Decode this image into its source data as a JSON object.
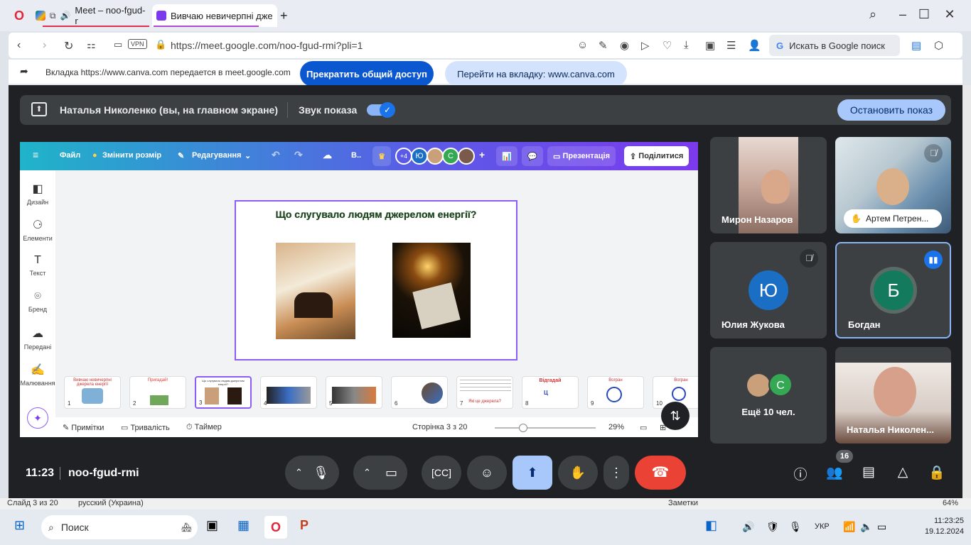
{
  "browser": {
    "tabs": [
      {
        "label": "Meet – noo-fgud-r"
      },
      {
        "label": "Вивчаю невичерпні дже"
      }
    ],
    "url": "https://meet.google.com/noo-fgud-rmi?pli=1",
    "vpn_label": "VPN",
    "google_search": "Искать в Google поиск"
  },
  "share_bar": {
    "text": "Вкладка https://www.canva.com передается в meet.google.com",
    "stop_label": "Прекратить общий доступ",
    "goto_label": "Перейти на вкладку: www.canva.com"
  },
  "presenter_bar": {
    "name": "Наталья Николенко (вы, на главном экране)",
    "sound_label": "Звук показа",
    "stop_label": "Остановить показ"
  },
  "canva": {
    "menu_file": "Файл",
    "resize": "Змінити розмір",
    "editing": "Редагування",
    "extra_label": "В..",
    "plus_count": "+4",
    "avatar_yu": "Ю",
    "avatar_s": "С",
    "present": "Презентація",
    "share": "Поділитися",
    "side": [
      "Дизайн",
      "Елементи",
      "Текст",
      "Бренд",
      "Передані",
      "Малювання"
    ],
    "slide_title": "Що слугувало людям джерелом енергії?",
    "thumbs": [
      {
        "num": "1",
        "title": "Вивчаю невичерпні джерела енергії"
      },
      {
        "num": "2",
        "title": "Пригадай!"
      },
      {
        "num": "3",
        "title": "Що слугувало людям джерелом енергії?"
      },
      {
        "num": "4",
        "title": ""
      },
      {
        "num": "5",
        "title": ""
      },
      {
        "num": "6",
        "title": ""
      },
      {
        "num": "7",
        "title": "Які це джерела?"
      },
      {
        "num": "8",
        "title": "Відгадай"
      },
      {
        "num": "9",
        "title": "Вогран"
      },
      {
        "num": "10",
        "title": "Вогран"
      }
    ],
    "notes": "Примітки",
    "duration": "Тривалість",
    "timer": "Таймер",
    "page": "Сторінка 3 з 20",
    "zoom": "29%",
    "zoom_fraction": 0.29
  },
  "participants": [
    {
      "name": "Мирон Назаров"
    },
    {
      "name": "Артем Петрен..."
    },
    {
      "name": "Юлия Жукова",
      "initial": "Ю"
    },
    {
      "name": "Богдан",
      "initial": "Б"
    },
    {
      "name": "Ещё 10 чел.",
      "initial": "С"
    },
    {
      "name": "Наталья Николен..."
    }
  ],
  "meeting": {
    "time": "11:23",
    "code": "noo-fgud-rmi",
    "people_count": "16"
  },
  "underlay": {
    "slide_info": "Слайд 3 из 20",
    "language": "русский (Украина)",
    "notes": "Заметки",
    "zoom": "64%"
  },
  "taskbar": {
    "search": "Поиск",
    "lang": "УКР",
    "time": "11:23:25",
    "date": "19.12.2024"
  },
  "colors": {
    "accent": "#0b57d0",
    "meet_bg": "#202124",
    "end_call": "#ea4335",
    "canva_purple": "#8b5cf6"
  }
}
